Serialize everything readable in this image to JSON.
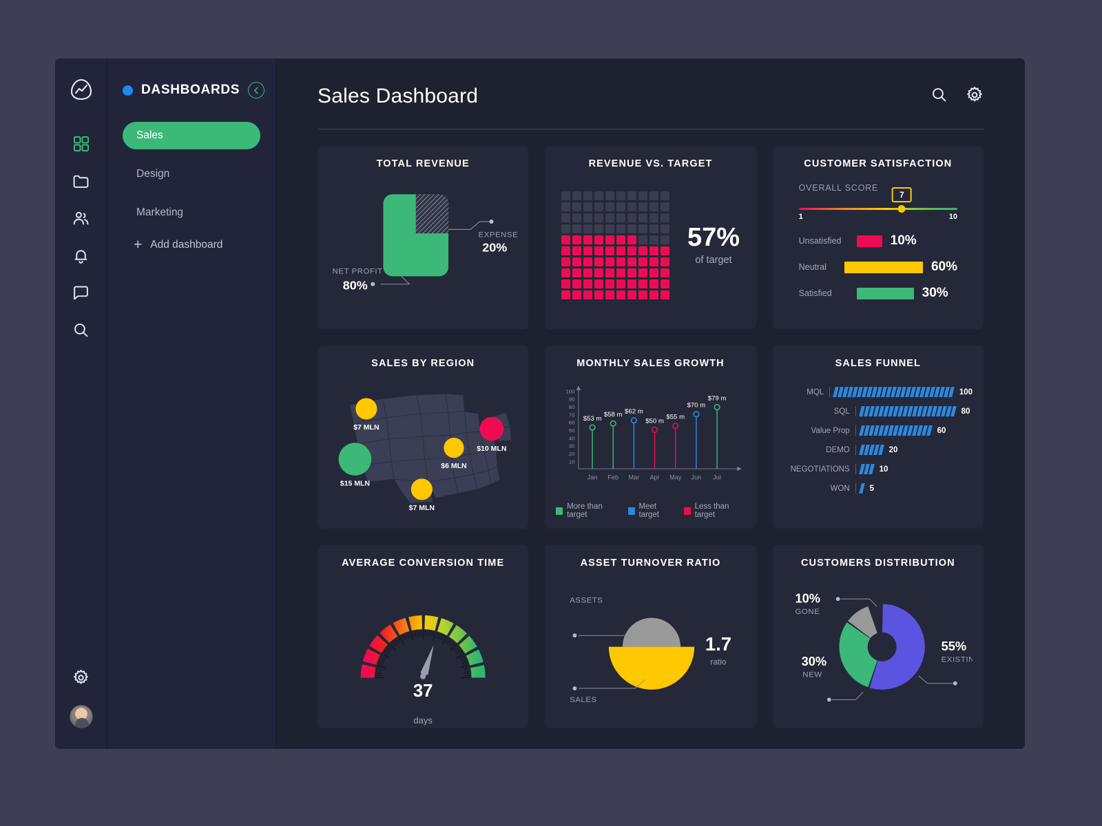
{
  "sidebar": {
    "logo_icon": "analytics-logo-icon",
    "rail_icons": [
      {
        "name": "dashboard-grid-icon",
        "active": true
      },
      {
        "name": "folder-icon",
        "active": false
      },
      {
        "name": "people-icon",
        "active": false
      },
      {
        "name": "bell-icon",
        "active": false
      },
      {
        "name": "chat-icon",
        "active": false
      },
      {
        "name": "search-icon",
        "active": false
      }
    ],
    "bottom_icons": [
      {
        "name": "gear-icon"
      },
      {
        "name": "avatar"
      }
    ],
    "panel_title": "DASHBOARDS",
    "collapse_icon": "chevron-left-icon",
    "items": [
      {
        "label": "Sales",
        "selected": true
      },
      {
        "label": "Design",
        "selected": false
      },
      {
        "label": "Marketing",
        "selected": false
      }
    ],
    "add_label": "Add dashboard"
  },
  "header": {
    "title": "Sales Dashboard",
    "search_icon": "search-icon",
    "settings_icon": "gear-icon"
  },
  "colors": {
    "green": "#3cb878",
    "red": "#ef0b53",
    "yellow": "#ffc800",
    "blue": "#2b89e0",
    "purple": "#5b54e0",
    "grey": "#9a9a9a"
  },
  "cards": {
    "total_revenue": {
      "title": "TOTAL REVENUE",
      "net_profit_label": "NET PROFIT",
      "net_profit_value": "80%",
      "expenses_label": "EXPENSES",
      "expenses_value": "20%"
    },
    "revenue_vs_target": {
      "title": "REVENUE VS. TARGET",
      "value": "57%",
      "caption": "of target"
    },
    "customer_satisfaction": {
      "title": "CUSTOMER SATISFACTION",
      "score_label": "OVERALL SCORE",
      "score_value": "7",
      "scale_min": "1",
      "scale_max": "10",
      "rows": [
        {
          "name": "Unsatisfied",
          "value": "10%",
          "pct": 10,
          "color": "#ef0b53"
        },
        {
          "name": "Neutral",
          "value": "60%",
          "pct": 60,
          "color": "#ffc800"
        },
        {
          "name": "Satisfied",
          "value": "30%",
          "pct": 30,
          "color": "#3cb878"
        }
      ]
    },
    "sales_by_region": {
      "title": "SALES BY REGION",
      "markers": [
        {
          "label": "$7 MLN",
          "color": "#ffc800",
          "x": 60,
          "y": 48,
          "r": 17
        },
        {
          "label": "$15 MLN",
          "color": "#3cb878",
          "x": 42,
          "y": 128,
          "r": 26
        },
        {
          "label": "$7 MLN",
          "color": "#ffc800",
          "x": 148,
          "y": 176,
          "r": 17
        },
        {
          "label": "$6 MLN",
          "color": "#ffc800",
          "x": 199,
          "y": 110,
          "r": 16
        },
        {
          "label": "$10 MLN",
          "color": "#ef0b53",
          "x": 259,
          "y": 80,
          "r": 19
        }
      ]
    },
    "monthly_sales_growth": {
      "title": "MONTHLY SALES GROWTH",
      "legend": [
        {
          "label": "More than target",
          "color": "#3cb878"
        },
        {
          "label": "Meet target",
          "color": "#2b89e0"
        },
        {
          "label": "Less than target",
          "color": "#ef0b53"
        }
      ]
    },
    "sales_funnel": {
      "title": "SALES FUNNEL",
      "stages": [
        {
          "name": "MQL",
          "value": 100
        },
        {
          "name": "SQL",
          "value": 80
        },
        {
          "name": "Value Prop",
          "value": 60
        },
        {
          "name": "DEMO",
          "value": 20
        },
        {
          "name": "NEGOTIATIONS",
          "value": 10
        },
        {
          "name": "WON",
          "value": 5
        }
      ]
    },
    "average_conversion_time": {
      "title": "AVERAGE CONVERSION TIME",
      "value": "37",
      "unit": "days"
    },
    "asset_turnover_ratio": {
      "title": "ASSET TURNOVER RATIO",
      "top_label": "ASSETS",
      "bottom_label": "SALES",
      "value": "1.7",
      "caption": "ratio"
    },
    "customers_distribution": {
      "title": "CUSTOMERS DISTRIBUTION",
      "slices": [
        {
          "name": "EXISTING",
          "value": "55%",
          "pct": 55,
          "color": "#5b54e0"
        },
        {
          "name": "NEW",
          "value": "30%",
          "pct": 30,
          "color": "#3cb878"
        },
        {
          "name": "GONE",
          "value": "10%",
          "pct": 10,
          "color": "#9a9a9a"
        }
      ]
    }
  },
  "chart_data": [
    {
      "type": "pie",
      "title": "TOTAL REVENUE",
      "labels": [
        "NET PROFIT",
        "EXPENSES"
      ],
      "values": [
        80,
        20
      ]
    },
    {
      "type": "waffle",
      "title": "REVENUE VS. TARGET",
      "filled": 57,
      "total": 100,
      "label": "57% of target"
    },
    {
      "type": "bar",
      "title": "CUSTOMER SATISFACTION",
      "categories": [
        "Unsatisfied",
        "Neutral",
        "Satisfied"
      ],
      "values": [
        10,
        60,
        30
      ],
      "score": 7,
      "score_range": [
        1,
        10
      ]
    },
    {
      "type": "scatter",
      "title": "SALES BY REGION",
      "points": [
        {
          "label": "$7 MLN",
          "value": 7
        },
        {
          "label": "$15 MLN",
          "value": 15
        },
        {
          "label": "$7 MLN",
          "value": 7
        },
        {
          "label": "$6 MLN",
          "value": 6
        },
        {
          "label": "$10 MLN",
          "value": 10
        }
      ]
    },
    {
      "type": "line",
      "title": "MONTHLY SALES GROWTH",
      "categories": [
        "Jan",
        "Feb",
        "Mar",
        "Apr",
        "May",
        "Jun",
        "Jul"
      ],
      "values": [
        53,
        58,
        62,
        50,
        55,
        70,
        79
      ],
      "labels": [
        "$53 m",
        "$58 m",
        "$62 m",
        "$50 m",
        "$55 m",
        "$70 m",
        "$79 m"
      ],
      "point_status": [
        "more",
        "more",
        "meet",
        "less",
        "less",
        "meet",
        "more"
      ],
      "ylabel": "",
      "xlabel": "",
      "ylim": [
        0,
        100
      ],
      "yticks": [
        10,
        20,
        30,
        40,
        50,
        60,
        70,
        80,
        90,
        100
      ],
      "grid": false,
      "legend": [
        "More than target",
        "Meet target",
        "Less than target"
      ]
    },
    {
      "type": "bar",
      "title": "SALES FUNNEL",
      "categories": [
        "MQL",
        "SQL",
        "Value Prop",
        "DEMO",
        "NEGOTIATIONS",
        "WON"
      ],
      "values": [
        100,
        80,
        60,
        20,
        10,
        5
      ]
    },
    {
      "type": "gauge",
      "title": "AVERAGE CONVERSION TIME",
      "value": 37,
      "unit": "days"
    },
    {
      "type": "pie",
      "title": "ASSET TURNOVER RATIO",
      "labels": [
        "ASSETS",
        "SALES"
      ],
      "ratio": 1.7
    },
    {
      "type": "pie",
      "title": "CUSTOMERS DISTRIBUTION",
      "labels": [
        "EXISTING",
        "NEW",
        "GONE"
      ],
      "values": [
        55,
        30,
        10
      ]
    }
  ]
}
